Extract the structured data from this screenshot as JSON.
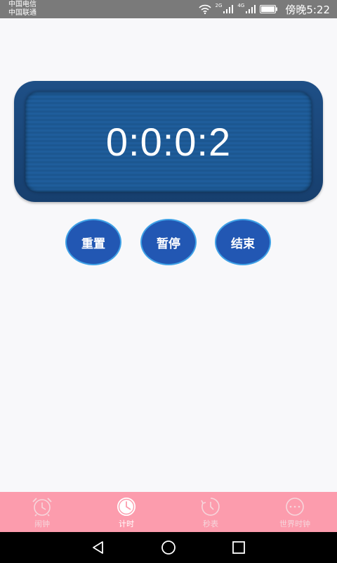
{
  "status_bar": {
    "carrier_1": "中国电信",
    "carrier_2": "中国联通",
    "net_1": "2G",
    "net_2": "4G",
    "time": "傍晚5:22"
  },
  "timer": {
    "display": "0:0:0:2"
  },
  "actions": {
    "reset_label": "重置",
    "pause_label": "暂停",
    "end_label": "结束"
  },
  "tabs": [
    {
      "label": "闹钟",
      "icon": "alarm-clock-icon",
      "active": false
    },
    {
      "label": "计时",
      "icon": "clock-icon",
      "active": true
    },
    {
      "label": "秒表",
      "icon": "stopwatch-icon",
      "active": false
    },
    {
      "label": "世界时钟",
      "icon": "world-clock-icon",
      "active": false
    }
  ],
  "colors": {
    "panel": "#1a4a80",
    "button": "#2257b3",
    "tab_bar": "#fc9cad"
  }
}
